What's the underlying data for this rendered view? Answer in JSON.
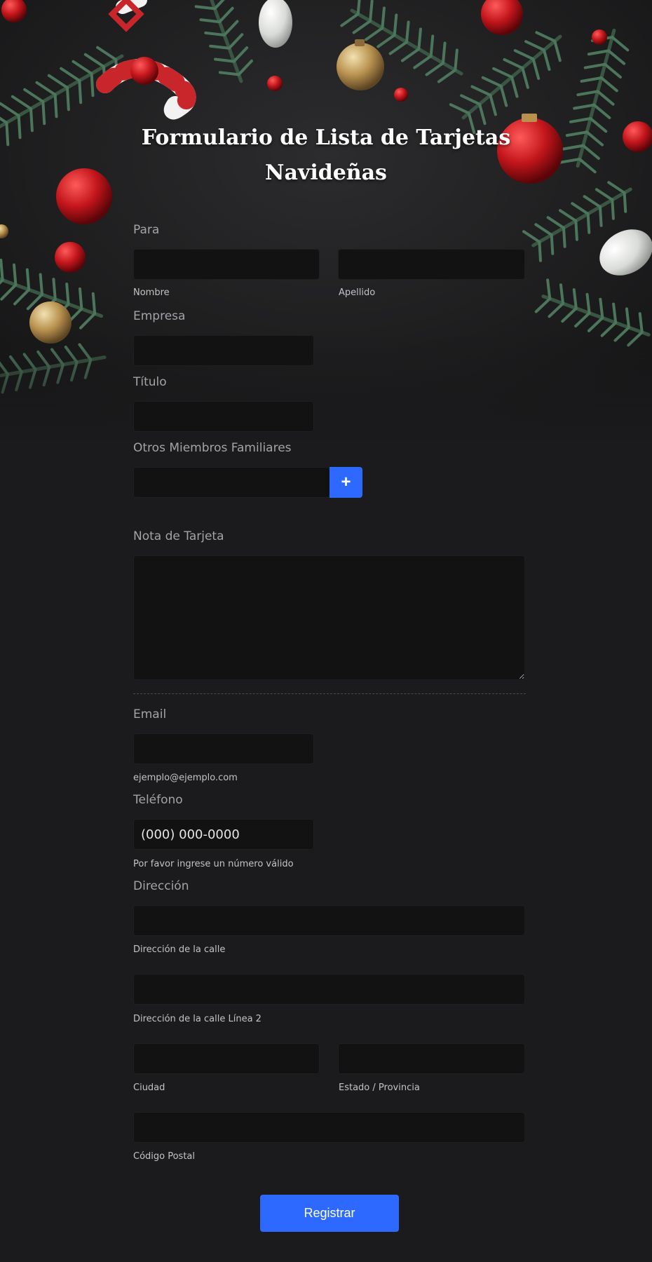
{
  "form": {
    "title": "Formulario de Lista de Tarjetas Navideñas",
    "para": {
      "label": "Para",
      "first_sublabel": "Nombre",
      "last_sublabel": "Apellido"
    },
    "empresa_label": "Empresa",
    "titulo_label": "Título",
    "otros_label": "Otros Miembros Familiares",
    "add_label": "+",
    "nota_label": "Nota de Tarjeta",
    "email": {
      "label": "Email",
      "sublabel": "ejemplo@ejemplo.com"
    },
    "telefono": {
      "label": "Teléfono",
      "placeholder": "(000) 000-0000",
      "sublabel": "Por favor ingrese un número válido"
    },
    "direccion": {
      "label": "Dirección",
      "street_sublabel": "Dirección de la calle",
      "street2_sublabel": "Dirección de la calle Línea 2",
      "city_sublabel": "Ciudad",
      "state_sublabel": "Estado / Provincia",
      "postal_sublabel": "Código Postal"
    },
    "submit_label": "Registrar"
  },
  "colors": {
    "background": "#1b1a1c",
    "field_bg": "#121213",
    "accent": "#2e69ff",
    "label": "#a3a3a8"
  },
  "icons": {
    "header_decoration": "christmas-pine-ornaments"
  }
}
